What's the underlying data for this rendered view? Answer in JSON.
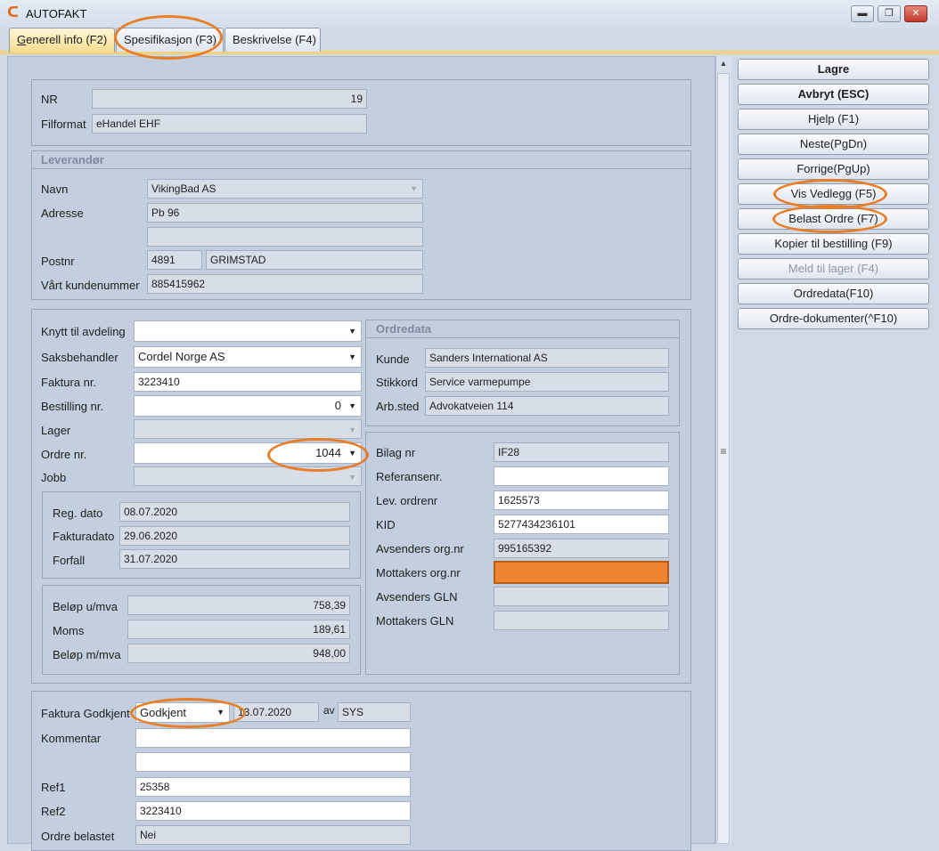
{
  "window": {
    "title": "AUTOFAKT",
    "minimize": "▬",
    "maximize": "❐",
    "close": "✕"
  },
  "tabs": [
    {
      "label": "Generell info (F2)",
      "underline": "G",
      "rest": "enerell info (F2)"
    },
    {
      "label": "Spesifikasjon (F3)"
    },
    {
      "label": "Beskrivelse (F4)"
    }
  ],
  "header": {
    "nr_label": "NR",
    "nr": "19",
    "filformat_label": "Filformat",
    "filformat": "eHandel EHF"
  },
  "leverandor": {
    "caption": "Leverandør",
    "navn_label": "Navn",
    "navn": "VikingBad AS",
    "adresse_label": "Adresse",
    "adresse1": "Pb 96",
    "adresse2": "",
    "postnr_label": "Postnr",
    "postnr": "4891",
    "poststed": "GRIMSTAD",
    "kundenummer_label": "Vårt kundenummer",
    "kundenummer": "885415962"
  },
  "order": {
    "avdeling_label": "Knytt til avdeling",
    "avdeling": "",
    "saksbehandler_label": "Saksbehandler",
    "saksbehandler": "Cordel Norge AS",
    "faktura_label": "Faktura nr.",
    "faktura": "3223410",
    "bestilling_label": "Bestilling nr.",
    "bestilling": "0",
    "lager_label": "Lager",
    "lager": "",
    "ordrenr_label": "Ordre nr.",
    "ordrenr": "1044",
    "jobb_label": "Jobb",
    "jobb": ""
  },
  "dates": {
    "reg_label": "Reg. dato",
    "reg": "08.07.2020",
    "faktura_label": "Fakturadato",
    "faktura": "29.06.2020",
    "forfall_label": "Forfall",
    "forfall": "31.07.2020"
  },
  "amounts": {
    "umva_label": "Beløp u/mva",
    "umva": "758,39",
    "moms_label": "Moms",
    "moms": "189,61",
    "mmva_label": "Beløp m/mva",
    "mmva": "948,00"
  },
  "ordredata": {
    "caption": "Ordredata",
    "kunde_label": "Kunde",
    "kunde": "Sanders International AS",
    "stikkord_label": "Stikkord",
    "stikkord": "Service varmepumpe",
    "arbsted_label": "Arb.sted",
    "arbsted": "Advokatveien 114"
  },
  "bilag": {
    "bilag_label": "Bilag nr",
    "bilag": "IF28",
    "referanse_label": "Referansenr.",
    "referanse": "",
    "levordre_label": "Lev. ordrenr",
    "levordre": "1625573",
    "kid_label": "KID",
    "kid": "5277434236101",
    "avs_org_label": "Avsenders org.nr",
    "avs_org": "995165392",
    "mot_org_label": "Mottakers org.nr",
    "mot_org": "",
    "avs_gln_label": "Avsenders GLN",
    "avs_gln": "",
    "mot_gln_label": "Mottakers GLN",
    "mot_gln": ""
  },
  "approval": {
    "godkjent_label": "Faktura Godkjent",
    "godkjent": "Godkjent",
    "dato": "13.07.2020",
    "av_label": "av",
    "av": "SYS",
    "kommentar_label": "Kommentar",
    "kommentar1": "",
    "kommentar2": "",
    "ref1_label": "Ref1",
    "ref1": "25358",
    "ref2_label": "Ref2",
    "ref2": "3223410",
    "belastet_label": "Ordre belastet",
    "belastet": "Nei"
  },
  "actions": {
    "lagre": "Lagre",
    "avbryt": "Avbryt (ESC)",
    "hjelp": "Hjelp (F1)",
    "neste": "Neste(PgDn)",
    "forrige": "Forrige(PgUp)",
    "vedlegg": "Vis Vedlegg (F5)",
    "belast": "Belast Ordre (F7)",
    "kopier": "Kopier til bestilling (F9)",
    "meld": "Meld til lager (F4)",
    "ordredata": "Ordredata(F10)",
    "dokumenter": "Ordre-dokumenter(^F10)"
  },
  "icons": {
    "app": "autofakt-logo",
    "dropdown": "chevron-down-icon",
    "scroll_up": "arrow-up-icon",
    "grip": "grip-icon"
  },
  "colors": {
    "accent_orange": "#e87f28",
    "active_tab": "#f5dc8e",
    "highlight_field": "#ef8533"
  }
}
